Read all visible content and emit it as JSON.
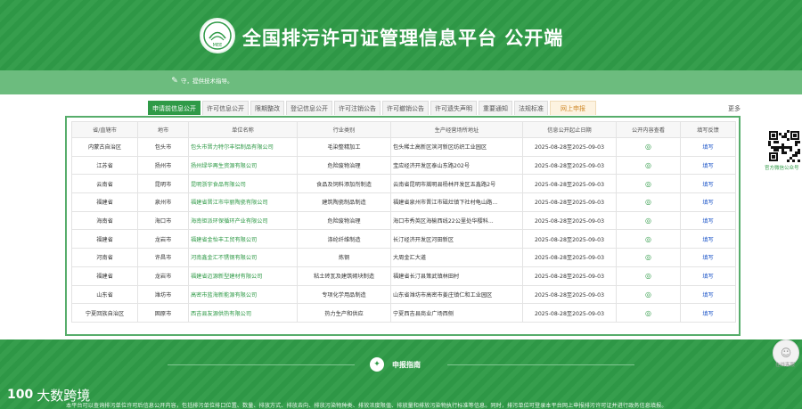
{
  "header": {
    "title": "全国排污许可证管理信息平台  公开端",
    "logo_text": "MEE",
    "notice": "守，提供技术指导。"
  },
  "tabs": [
    {
      "label": "申请前信息公开",
      "active": true
    },
    {
      "label": "许可信息公开"
    },
    {
      "label": "限期整改"
    },
    {
      "label": "登记信息公开"
    },
    {
      "label": "许可注销公告"
    },
    {
      "label": "许可撤销公告"
    },
    {
      "label": "许可遗失声明"
    },
    {
      "label": "重要通知"
    },
    {
      "label": "法规标准"
    },
    {
      "label": "网上申报",
      "report": true
    }
  ],
  "more_label": "更多",
  "table": {
    "headers": [
      "省/直辖市",
      "地市",
      "单位名称",
      "行业类别",
      "生产经营场所地址",
      "信息公开起止日期",
      "公开内容查看",
      "填写反馈"
    ],
    "fill_label": "填写",
    "rows": [
      {
        "province": "内蒙古自治区",
        "city": "包头市",
        "company": "包头市晋力特尔丰铝制品有限公司",
        "industry": "毛染整精加工",
        "address": "包头稀土高新区滨河新区纺织工业园区",
        "dates": "2025-08-28至2025-09-03"
      },
      {
        "province": "江苏省",
        "city": "扬州市",
        "company": "扬州绿华再生资源有限公司",
        "industry": "危险废物治理",
        "address": "宝应经济开发区泰山东路202号",
        "dates": "2025-08-28至2025-09-03"
      },
      {
        "province": "云南省",
        "city": "昆明市",
        "company": "昆明浙宇食品有限公司",
        "industry": "食品及饲料添加剂制造",
        "address": "云南省昆明市嵩明县杨林开发区五鑫路2号",
        "dates": "2025-08-28至2025-09-03"
      },
      {
        "province": "福建省",
        "city": "泉州市",
        "company": "福建省晋江市华丽陶瓷有限公司",
        "industry": "建筑陶瓷制品制造",
        "address": "福建省泉州市晋江市磁灶镇下社村龟山路...",
        "dates": "2025-08-28至2025-09-03"
      },
      {
        "province": "海南省",
        "city": "海口市",
        "company": "海南钜派环保循环产业有限公司",
        "industry": "危险废物治理",
        "address": "海口市秀英区海榆西线22公里处华樱科...",
        "dates": "2025-08-28至2025-09-03"
      },
      {
        "province": "福建省",
        "city": "龙岩市",
        "company": "福建省金怡丰工贸有限公司",
        "industry": "涤纶纤维制造",
        "address": "长汀经济开发区河田新区",
        "dates": "2025-08-28至2025-09-03"
      },
      {
        "province": "河南省",
        "city": "许昌市",
        "company": "河南鑫金汇不锈钢有限公司",
        "industry": "炼钢",
        "address": "大周金汇大道",
        "dates": "2025-08-28至2025-09-03"
      },
      {
        "province": "福建省",
        "city": "龙岩市",
        "company": "福建省迈源新型建材有限公司",
        "industry": "粘土砖瓦及建筑砌块制造",
        "address": "福建省长汀县策武镇林田村",
        "dates": "2025-08-28至2025-09-03"
      },
      {
        "province": "山东省",
        "city": "潍坊市",
        "company": "高密市蓝海新能源有限公司",
        "industry": "专项化学用品制造",
        "address": "山东省潍坊市高密市姜庄镇仁和工业园区",
        "dates": "2025-08-28至2025-09-03"
      },
      {
        "province": "宁夏回族自治区",
        "city": "固原市",
        "company": "西吉县友源供热有限公司",
        "industry": "热力生产和供应",
        "address": "宁夏西吉县商业广场西侧",
        "dates": "2025-08-28至2025-09-03"
      }
    ]
  },
  "sidebar": {
    "qr_label": "官方微信公众号",
    "service_label": "在线客服"
  },
  "footer": {
    "guide_title": "申报指南",
    "text": "本平台可以查询排污单位许可后信息公开内容，包括排污单位排口位置、数量、排放方式、排放去向、排放污染物种类、排放浓度限值、排放量和排放污染物执行标准等信息。同时，排污单位可登录本平台网上申报排污许可证并进行政务信息填报。"
  },
  "watermark": {
    "logo": "100",
    "text": "大数跨境"
  },
  "colors": {
    "primary": "#2f9a47",
    "notice_bar": "#6cbc7e",
    "link": "#1f57c9"
  }
}
